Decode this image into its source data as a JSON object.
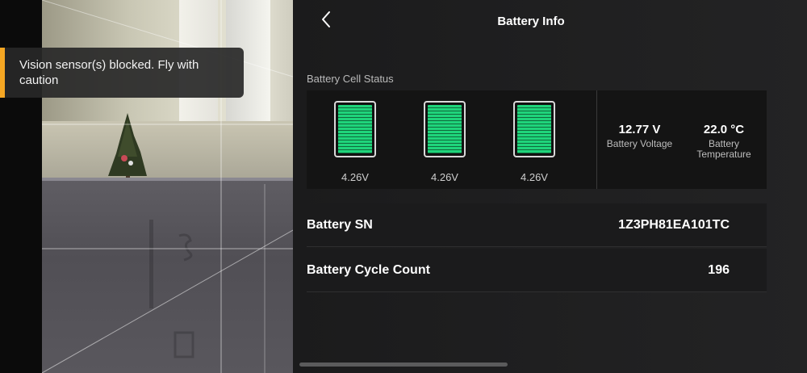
{
  "toast": {
    "message": "Vision sensor(s) blocked. Fly with caution",
    "accent_color": "#f5a623"
  },
  "header": {
    "title": "Battery Info",
    "back_icon": "chevron-left-icon"
  },
  "cell_status": {
    "label": "Battery Cell Status",
    "cells": [
      {
        "voltage": "4.26V",
        "fill_level": 1.0
      },
      {
        "voltage": "4.26V",
        "fill_level": 1.0
      },
      {
        "voltage": "4.26V",
        "fill_level": 1.0
      }
    ],
    "cell_color": "#1fd47b"
  },
  "stats": {
    "voltage_value": "12.77 V",
    "voltage_label": "Battery Voltage",
    "temperature_value": "22.0 °C",
    "temperature_label": "Battery Temperature"
  },
  "info_rows": [
    {
      "label": "Battery SN",
      "value": "1Z3PH81EA101TC"
    },
    {
      "label": "Battery Cycle Count",
      "value": "196"
    }
  ]
}
